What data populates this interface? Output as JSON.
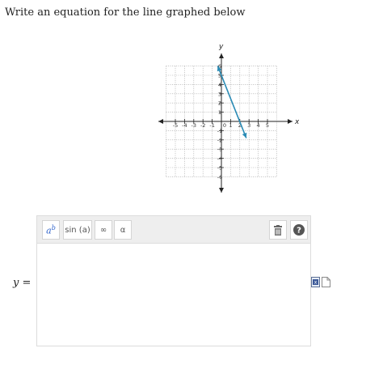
{
  "question": {
    "text": "Write an equation for the line graphed below"
  },
  "graph": {
    "axis_x_label": "x",
    "axis_y_label": "y",
    "x_range": [
      -6,
      6
    ],
    "y_range": [
      -6,
      6
    ],
    "grid": true,
    "x_tick_labels": [
      "-5",
      "-4",
      "-3",
      "-2",
      "-1",
      "0",
      "1",
      "2",
      "3",
      "4",
      "5"
    ],
    "y_tick_labels": [
      "6",
      "5",
      "4",
      "3",
      "2",
      "1",
      "-1",
      "-2",
      "-3",
      "-4",
      "-5",
      "-6"
    ],
    "line": {
      "x1": -0.4,
      "y1": 6,
      "x2": 2.7,
      "y2": -1.8,
      "color": "#2a8bb5"
    }
  },
  "toolbar": {
    "superscript_label": "a",
    "superscript_exp": "b",
    "sin_label": "sin (a)",
    "infinity_label": "∞",
    "alpha_label": "α",
    "trash_icon": "trash-icon",
    "help_icon": "help-icon",
    "help_label": "?"
  },
  "answer": {
    "prefix": "y",
    "equals": "=",
    "value": ""
  },
  "side_icons": [
    "formula-icon",
    "file-icon"
  ]
}
